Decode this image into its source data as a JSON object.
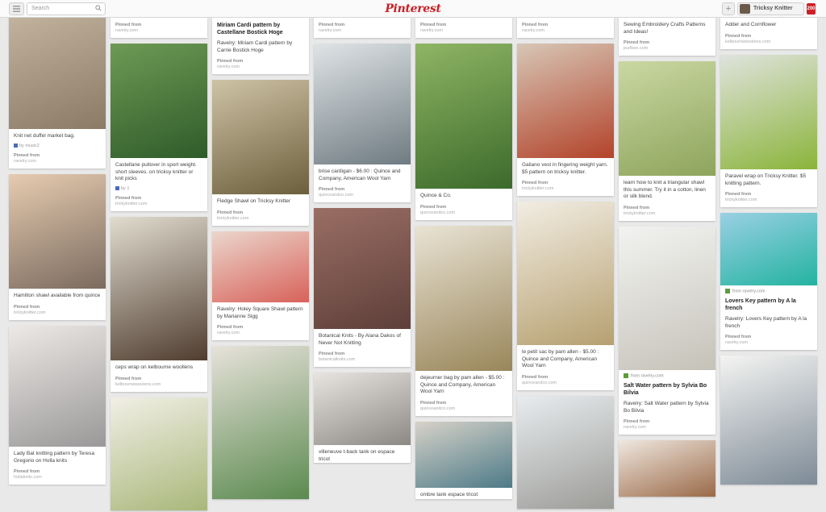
{
  "header": {
    "search_placeholder": "Search",
    "logo": "Pinterest",
    "user_name": "Tricksy Knitter",
    "notification_count": "200"
  },
  "brand_color": "#cb2027",
  "pinned_label": "Pinned from",
  "columns": [
    [
      {
        "height": 160,
        "colors": [
          "#c8b9a4",
          "#8a7a66"
        ],
        "desc": "Knit net duffel market bag.",
        "by": "by music2",
        "domain": "ravelry.com"
      },
      {
        "height": 142,
        "colors": [
          "#e6cbb0",
          "#7b6b5f"
        ],
        "desc": "Hamilton shawl available from quince",
        "domain": "trickyknitter.com"
      },
      {
        "height": 150,
        "colors": [
          "#ece9e6",
          "#9a9898"
        ],
        "desc": "Lady Bat knitting pattern by Teresa Gregorio on Holla knits",
        "domain": "hollaknits.com"
      }
    ],
    [
      {
        "height": 0,
        "colors": [
          "#ffffff",
          "#ffffff"
        ],
        "desc": "",
        "domain": "ravelry.com"
      },
      {
        "height": 142,
        "colors": [
          "#6e9a55",
          "#2f5b2a"
        ],
        "desc": "Castellane pullover in sport weight. short sleeves. on tricksy knitter or knit picks",
        "by": "by 1",
        "domain": "trickyknitter.com"
      },
      {
        "height": 178,
        "colors": [
          "#e1dccf",
          "#4f3d30"
        ],
        "desc": "ceps wrap on kelbourne woollens",
        "domain": "kelbournewoolens.com"
      },
      {
        "height": 140,
        "colors": [
          "#f1efe6",
          "#a9b77a"
        ],
        "desc": "",
        "domain": ""
      }
    ],
    [
      {
        "height": 0,
        "colors": [
          "#ffffff",
          "#ffffff"
        ],
        "title": "Miriam Cardi pattern by Castellane Bostick Hoge",
        "desc": "Ravelry: Miriam Cardi pattern by Carrie Bostick Hoge",
        "domain": "ravelry.com"
      },
      {
        "height": 142,
        "colors": [
          "#cfc3a6",
          "#6b5f3c"
        ],
        "desc": "Fledge Shawl on Tricksy Knitter",
        "domain": "trickyknitter.com"
      },
      {
        "height": 88,
        "colors": [
          "#ebd6cc",
          "#d8625a"
        ],
        "desc": "Ravelry: Holey Square Shawl pattern by Marianne Sigg",
        "domain": "ravelry.com"
      },
      {
        "height": 190,
        "colors": [
          "#e7e2da",
          "#5b8a4f"
        ],
        "desc": "",
        "domain": ""
      }
    ],
    [
      {
        "height": 0,
        "colors": [
          "#ffffff",
          "#ffffff"
        ],
        "desc": "",
        "domain": "ravelry.com"
      },
      {
        "height": 150,
        "colors": [
          "#dfe4e6",
          "#6f7b82"
        ],
        "desc": "brise cardigan - $6.00 : Quince and Company, American Wool Yarn",
        "domain": "quinceandco.com"
      },
      {
        "height": 150,
        "colors": [
          "#9a6e64",
          "#5e3f3a"
        ],
        "desc": "Botanical Knits - By Alana Dakos of Never Not Knitting",
        "domain": "botanicalknits.com"
      },
      {
        "height": 90,
        "colors": [
          "#e8e5e1",
          "#8c8884"
        ],
        "desc": "villeneuve t-back tank on espace tricot",
        "domain": ""
      }
    ],
    [
      {
        "height": 0,
        "colors": [
          "#ffffff",
          "#ffffff"
        ],
        "desc": "",
        "domain": "ravelry.com"
      },
      {
        "height": 180,
        "colors": [
          "#8fb564",
          "#3c6a2b"
        ],
        "desc": "Quince & Co.",
        "domain": "quinceandco.com"
      },
      {
        "height": 180,
        "colors": [
          "#e9e3d4",
          "#99865a"
        ],
        "desc": "dejeurner bag by pam allen - $5.00 : Quince and Company, American Wool Yarn",
        "domain": "quinceandco.com"
      },
      {
        "height": 82,
        "colors": [
          "#d6d2c8",
          "#4d7a88"
        ],
        "desc": "ombre tank espace tricot",
        "domain": ""
      }
    ],
    [
      {
        "height": 0,
        "colors": [
          "#ffffff",
          "#ffffff"
        ],
        "desc": "",
        "domain": "ravelry.com"
      },
      {
        "height": 142,
        "colors": [
          "#d7c6b6",
          "#b3432a"
        ],
        "desc": "Galiano vest in fingering weight yarn. $5 pattern on tricksy knitter.",
        "domain": "trickyknitter.com"
      },
      {
        "height": 178,
        "colors": [
          "#f2ede3",
          "#b6a070"
        ],
        "desc": "le petit sac by pam allen - $5.00 : Quince and Company, American Wool Yarn",
        "domain": "quinceandco.com"
      },
      {
        "height": 140,
        "colors": [
          "#e8ecef",
          "#9c9c98"
        ],
        "desc": "",
        "domain": ""
      }
    ],
    [
      {
        "height": 0,
        "colors": [
          "#ffffff",
          "#ffffff"
        ],
        "desc": "Sewing Embroidery Crafts Patterns and Ideas!",
        "domain": "purlbee.com"
      },
      {
        "height": 142,
        "colors": [
          "#c9d8a2",
          "#8ea45c"
        ],
        "desc": "learn how to knit a triangular shawl this summer. Try it in a cotton, linen or silk blend.",
        "domain": "trickyknitter.com"
      },
      {
        "height": 178,
        "colors": [
          "#f2f3f1",
          "#c5c2b8"
        ],
        "source": "from ravelry.com",
        "title": "Salt Water pattern by Sylvia Bo Bilvia",
        "desc": "Ravelry: Salt Water pattern by Sylvia Bo Bilvia",
        "domain": "ravelry.com"
      },
      {
        "height": 70,
        "colors": [
          "#efe7df",
          "#9a6a48"
        ],
        "desc": "",
        "domain": ""
      }
    ],
    [
      {
        "height": 0,
        "colors": [
          "#ffffff",
          "#ffffff"
        ],
        "desc": "Adder and Cornflower",
        "domain": "kelbournewoolens.com"
      },
      {
        "height": 142,
        "colors": [
          "#dfe3dd",
          "#8bb43a"
        ],
        "desc": "Paravel wrap on Tricksy Knitter. $5 knitting pattern.",
        "domain": "trickyknitter.com"
      },
      {
        "height": 90,
        "colors": [
          "#9ad0e4",
          "#23b3a0"
        ],
        "source": "from ravelry.com",
        "title": "Lovers Key pattern by A la french",
        "desc": "Ravelry: Lovers Key pattern by A la french",
        "domain": "ravelry.com"
      },
      {
        "height": 160,
        "colors": [
          "#f4f4f2",
          "#7d8a96"
        ],
        "desc": "",
        "domain": ""
      }
    ]
  ]
}
